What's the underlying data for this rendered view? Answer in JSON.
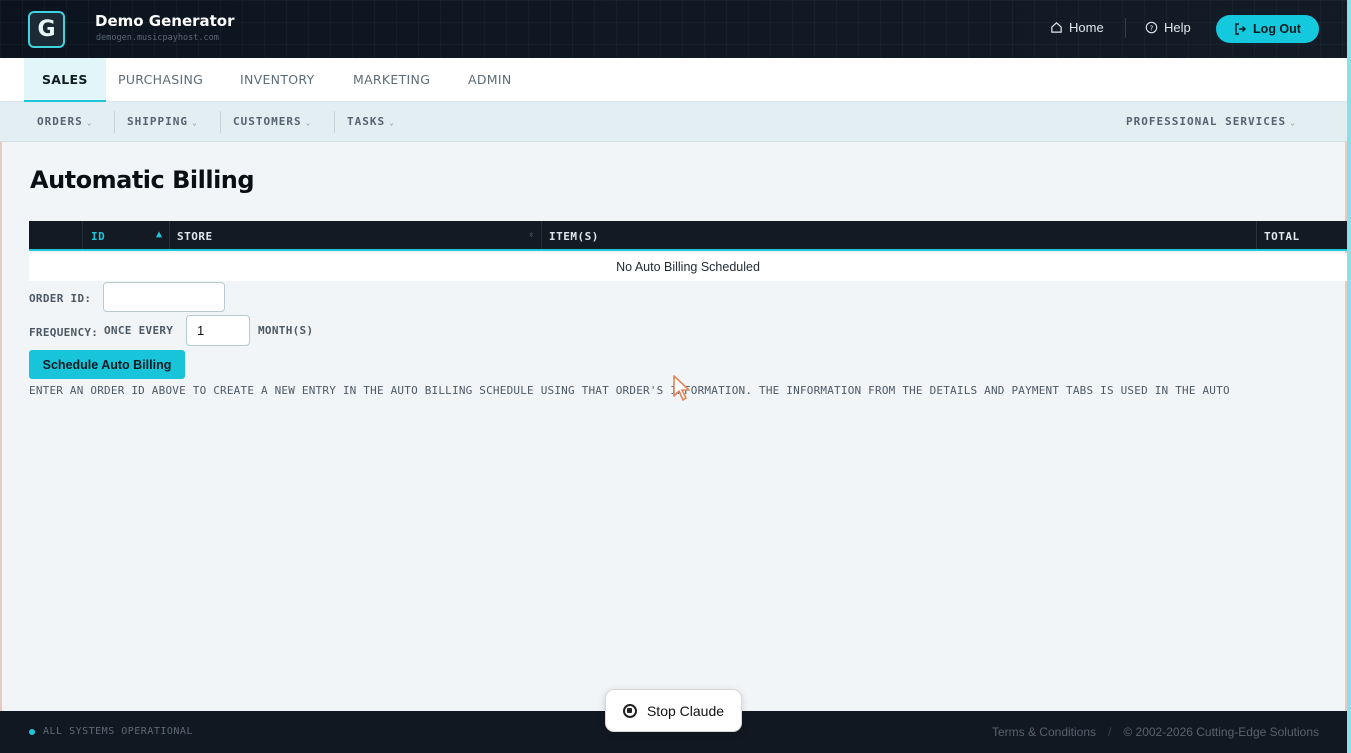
{
  "header": {
    "logo_glyph": "G",
    "title": "Demo Generator",
    "subtitle": "demogen.musicpayhost.com",
    "home_label": "Home",
    "help_label": "Help",
    "logout_label": "Log Out",
    "accent_color": "#14c8dd"
  },
  "tabs": [
    {
      "label": "SALES",
      "active": true
    },
    {
      "label": "PURCHASING"
    },
    {
      "label": "INVENTORY"
    },
    {
      "label": "MARKETING"
    },
    {
      "label": "ADMIN"
    }
  ],
  "subnav": {
    "items": [
      "ORDERS",
      "SHIPPING",
      "CUSTOMERS",
      "TASKS"
    ],
    "right_item": "PROFESSIONAL SERVICES"
  },
  "page": {
    "title": "Automatic Billing"
  },
  "table": {
    "columns": [
      "ID",
      "STORE",
      "ITEM(S)",
      "TOTAL"
    ],
    "sort_column": "ID",
    "empty_message": "No Auto Billing Scheduled"
  },
  "form": {
    "order_id_label": "ORDER ID:",
    "order_id_value": "",
    "frequency_label": "FREQUENCY:",
    "once_every_label": "ONCE EVERY",
    "months_value": "1",
    "months_unit": "MONTH(S)",
    "schedule_button": "Schedule Auto Billing",
    "hint": "ENTER AN ORDER ID ABOVE TO CREATE A NEW ENTRY IN THE AUTO BILLING SCHEDULE USING THAT ORDER'S INFORMATION. THE INFORMATION FROM THE DETAILS AND PAYMENT TABS IS USED IN THE AUTO"
  },
  "footer": {
    "status": "ALL SYSTEMS OPERATIONAL",
    "terms": "Terms & Conditions",
    "copyright": "© 2002-2026 Cutting-Edge Solutions"
  },
  "overlay": {
    "stop_label": "Stop Claude"
  }
}
